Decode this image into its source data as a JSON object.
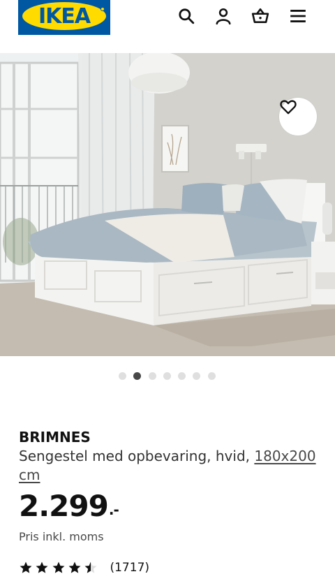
{
  "header": {
    "logo_text": "IKEA",
    "icons": [
      "search-icon",
      "account-icon",
      "basket-icon",
      "menu-icon"
    ]
  },
  "gallery": {
    "image_count": 7,
    "active_index": 1,
    "favorite_icon": "heart-icon"
  },
  "product": {
    "name": "BRIMNES",
    "description": "Sengestel med opbevaring, hvid,",
    "size": "180x200 cm",
    "price_integer": "2.299",
    "price_decimal": ".-",
    "vat_note": "Pris inkl. moms",
    "rating": 4.5,
    "rating_max": 5,
    "review_count": "(1717)"
  },
  "colors": {
    "ikea_blue": "#0058a3",
    "ikea_yellow": "#ffdb00"
  }
}
